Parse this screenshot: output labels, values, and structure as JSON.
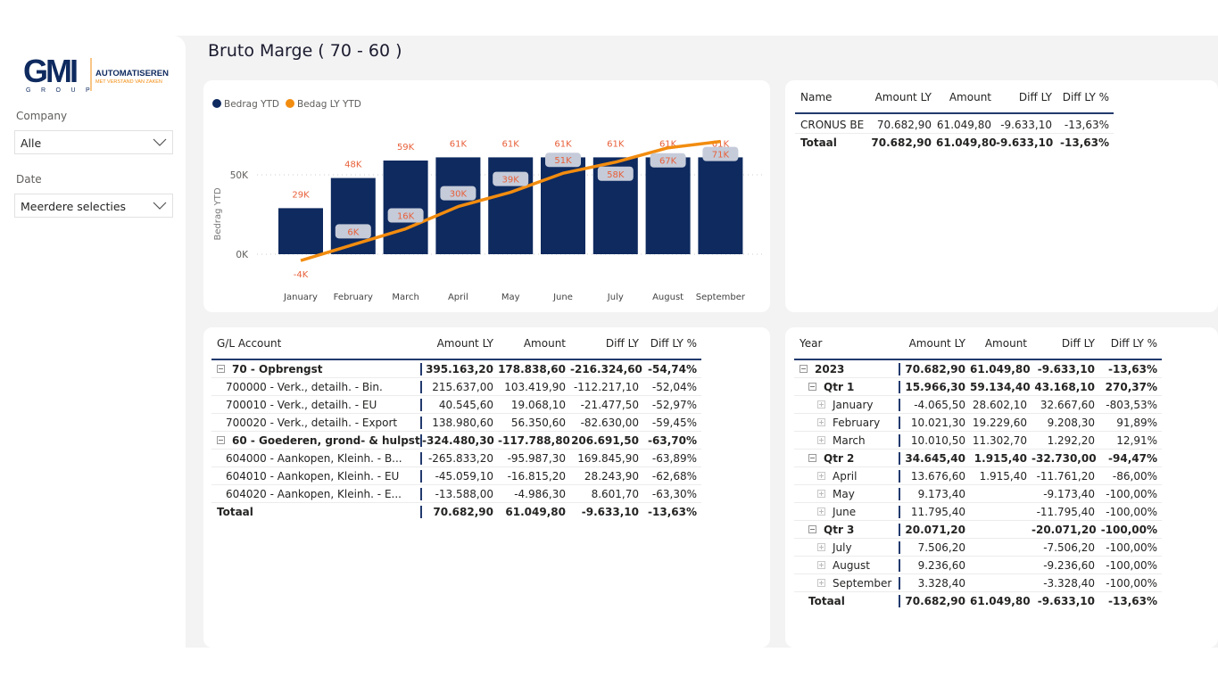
{
  "page": {
    "title": "Bruto Marge ( 70 - 60 )"
  },
  "logo": {
    "main": "GMI",
    "sub": "GROUP",
    "tagline1": "AUTOMATISEREN",
    "tagline2": "MET VERSTAND VAN ZAKEN"
  },
  "filters": [
    {
      "label": "Company",
      "value": "Alle",
      "icon": "chevron-down"
    },
    {
      "label": "Date",
      "value": "Meerdere selecties",
      "icon": "chevron-down"
    }
  ],
  "colors": {
    "bar": "#0e2a5f",
    "line": "#f28c0f",
    "label": "#e8603a",
    "accent": "#223a6e"
  },
  "chart_data": {
    "type": "bar+line",
    "legend": [
      {
        "name": "Bedrag YTD",
        "color": "#0e2a5f"
      },
      {
        "name": "Bedag LY YTD",
        "color": "#f28c0f"
      }
    ],
    "legend_position": "top-left",
    "categories": [
      "January",
      "February",
      "March",
      "April",
      "May",
      "June",
      "July",
      "August",
      "September"
    ],
    "ylabel": "Bedrag YTD",
    "yticks": [
      "0K",
      "50K"
    ],
    "ytick_values": [
      0,
      50
    ],
    "grid": true,
    "series": [
      {
        "name": "Bedrag YTD",
        "type": "bar",
        "values": [
          29,
          48,
          59,
          61,
          61,
          61,
          61,
          61,
          61
        ],
        "labels": [
          "29K",
          "48K",
          "59K",
          "61K",
          "61K",
          "61K",
          "61K",
          "61K",
          "61K"
        ]
      },
      {
        "name": "Bedag LY YTD",
        "type": "line",
        "values": [
          -4,
          6,
          16,
          30,
          39,
          51,
          58,
          67,
          71
        ],
        "labels": [
          "-4K",
          "6K",
          "16K",
          "30K",
          "39K",
          "51K",
          "58K",
          "67K",
          "71K"
        ]
      }
    ]
  },
  "summary": {
    "headers": [
      "Name",
      "Amount LY",
      "Amount",
      "Diff LY",
      "Diff LY %"
    ],
    "rows": [
      {
        "cells": [
          "CRONUS BE",
          "70.682,90",
          "61.049,80",
          "-9.633,10",
          "-13,63%"
        ],
        "type": ""
      },
      {
        "cells": [
          "Totaal",
          "70.682,90",
          "61.049,80",
          "-9.633,10",
          "-13,63%"
        ],
        "type": "tot"
      }
    ]
  },
  "gl": {
    "headers": [
      "G/L Account",
      "Amount LY",
      "Amount",
      "Diff LY",
      "Diff LY %"
    ],
    "rows": [
      {
        "cells": [
          "70 - Opbrengst",
          "395.163,20",
          "178.838,60",
          "-216.324,60",
          "-54,74%"
        ],
        "type": "b",
        "level": 0,
        "toggle": "minus"
      },
      {
        "cells": [
          "700000 - Verk., detailh. - Bin.",
          "215.637,00",
          "103.419,90",
          "-112.217,10",
          "-52,04%"
        ],
        "type": "",
        "level": 1
      },
      {
        "cells": [
          "700010 - Verk., detailh. - EU",
          "40.545,60",
          "19.068,10",
          "-21.477,50",
          "-52,97%"
        ],
        "type": "",
        "level": 1
      },
      {
        "cells": [
          "700020 - Verk., detailh. - Export",
          "138.980,60",
          "56.350,60",
          "-82.630,00",
          "-59,45%"
        ],
        "type": "",
        "level": 1
      },
      {
        "cells": [
          "60 - Goederen, grond- & hulpsto...",
          "-324.480,30",
          "-117.788,80",
          "206.691,50",
          "-63,70%"
        ],
        "type": "b",
        "level": 0,
        "toggle": "minus"
      },
      {
        "cells": [
          "604000 - Aankopen, Kleinh. - B...",
          "-265.833,20",
          "-95.987,30",
          "169.845,90",
          "-63,89%"
        ],
        "type": "",
        "level": 1
      },
      {
        "cells": [
          "604010 - Aankopen, Kleinh. - EU",
          "-45.059,10",
          "-16.815,20",
          "28.243,90",
          "-62,68%"
        ],
        "type": "",
        "level": 1
      },
      {
        "cells": [
          "604020 - Aankopen, Kleinh. - E...",
          "-13.588,00",
          "-4.986,30",
          "8.601,70",
          "-63,30%"
        ],
        "type": "",
        "level": 1
      },
      {
        "cells": [
          "Totaal",
          "70.682,90",
          "61.049,80",
          "-9.633,10",
          "-13,63%"
        ],
        "type": "tot",
        "level": 0
      }
    ]
  },
  "period": {
    "headers": [
      "Year",
      "Amount LY",
      "Amount",
      "Diff LY",
      "Diff LY %"
    ],
    "rows": [
      {
        "cells": [
          "2023",
          "70.682,90",
          "61.049,80",
          "-9.633,10",
          "-13,63%"
        ],
        "type": "b",
        "level": 0,
        "toggle": "minus"
      },
      {
        "cells": [
          "Qtr 1",
          "15.966,30",
          "59.134,40",
          "43.168,10",
          "270,37%"
        ],
        "type": "b",
        "level": 1,
        "toggle": "minus"
      },
      {
        "cells": [
          "January",
          "-4.065,50",
          "28.602,10",
          "32.667,60",
          "-803,53%"
        ],
        "type": "",
        "level": 2,
        "toggle": "plus"
      },
      {
        "cells": [
          "February",
          "10.021,30",
          "19.229,60",
          "9.208,30",
          "91,89%"
        ],
        "type": "",
        "level": 2,
        "toggle": "plus"
      },
      {
        "cells": [
          "March",
          "10.010,50",
          "11.302,70",
          "1.292,20",
          "12,91%"
        ],
        "type": "",
        "level": 2,
        "toggle": "plus"
      },
      {
        "cells": [
          "Qtr 2",
          "34.645,40",
          "1.915,40",
          "-32.730,00",
          "-94,47%"
        ],
        "type": "b",
        "level": 1,
        "toggle": "minus"
      },
      {
        "cells": [
          "April",
          "13.676,60",
          "1.915,40",
          "-11.761,20",
          "-86,00%"
        ],
        "type": "",
        "level": 2,
        "toggle": "plus"
      },
      {
        "cells": [
          "May",
          "9.173,40",
          "",
          "-9.173,40",
          "-100,00%"
        ],
        "type": "",
        "level": 2,
        "toggle": "plus"
      },
      {
        "cells": [
          "June",
          "11.795,40",
          "",
          "-11.795,40",
          "-100,00%"
        ],
        "type": "",
        "level": 2,
        "toggle": "plus"
      },
      {
        "cells": [
          "Qtr 3",
          "20.071,20",
          "",
          "-20.071,20",
          "-100,00%"
        ],
        "type": "b",
        "level": 1,
        "toggle": "minus"
      },
      {
        "cells": [
          "July",
          "7.506,20",
          "",
          "-7.506,20",
          "-100,00%"
        ],
        "type": "",
        "level": 2,
        "toggle": "plus"
      },
      {
        "cells": [
          "August",
          "9.236,60",
          "",
          "-9.236,60",
          "-100,00%"
        ],
        "type": "",
        "level": 2,
        "toggle": "plus"
      },
      {
        "cells": [
          "September",
          "3.328,40",
          "",
          "-3.328,40",
          "-100,00%"
        ],
        "type": "",
        "level": 2,
        "toggle": "plus"
      },
      {
        "cells": [
          "Totaal",
          "70.682,90",
          "61.049,80",
          "-9.633,10",
          "-13,63%"
        ],
        "type": "tot",
        "level": 1
      }
    ]
  }
}
